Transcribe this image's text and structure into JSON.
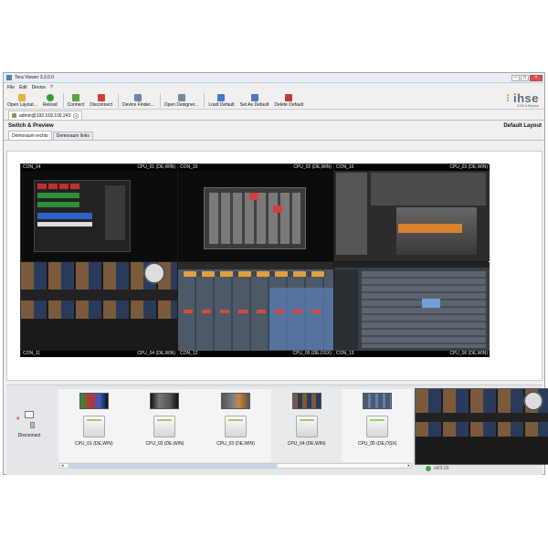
{
  "window": {
    "title": "Tera Viewer 3.3.0.0",
    "controls": {
      "minimize": "–",
      "maximize": "□",
      "close": "×"
    }
  },
  "menu": [
    "File",
    "Edit",
    "Device",
    "?"
  ],
  "toolbar": {
    "buttons": [
      {
        "label": "Open Layout...",
        "icon": "folder-icon",
        "color": "#e6b43c"
      },
      {
        "label": "Reload",
        "icon": "reload-icon",
        "color": "#3a9a3a"
      },
      {
        "label": "Connect",
        "icon": "connect-icon",
        "color": "#58a23c"
      },
      {
        "label": "Disconnect",
        "icon": "disconnect-icon",
        "color": "#d04030"
      },
      {
        "label": "Device Finder...",
        "icon": "device-finder-icon",
        "color": "#6b87a8"
      },
      {
        "label": "Open Designer...",
        "icon": "designer-icon",
        "color": "#7a8a9a"
      },
      {
        "label": "Load Default",
        "icon": "load-default-icon",
        "color": "#4a78c2"
      },
      {
        "label": "Set As Default",
        "icon": "set-default-icon",
        "color": "#4a78c2"
      },
      {
        "label": "Delete Default",
        "icon": "delete-default-icon",
        "color": "#c03a3a"
      }
    ]
  },
  "logo": {
    "name": "ihse",
    "tagline": "KVM & Beyond"
  },
  "connection_tab": {
    "label": "admin@192.169.100.243"
  },
  "section": {
    "title": "Switch & Preview",
    "layout": "Default Layout"
  },
  "subtabs": [
    {
      "label": "Demoraum rechts",
      "active": true
    },
    {
      "label": "Demoraum links",
      "active": false
    }
  ],
  "consoles": [
    {
      "con": "CON_14",
      "cpu": "CPU_01 (DE,WIN)",
      "label_pos": "top"
    },
    {
      "con": "CON_15",
      "cpu": "CPU_02 (DE,WIN)",
      "label_pos": "top"
    },
    {
      "con": "CON_16",
      "cpu": "CPU_03 (DE,WIN)",
      "label_pos": "top"
    },
    {
      "con": "CON_11",
      "cpu": "CPU_04 (DE,WIN)",
      "label_pos": "bottom"
    },
    {
      "con": "CON_12",
      "cpu": "CPU_05 (DE,OSX)",
      "label_pos": "bottom"
    },
    {
      "con": "CON_13",
      "cpu": "CPU_06 (DE,WIN)",
      "label_pos": "bottom"
    }
  ],
  "disconnect": {
    "label": "Disconnect"
  },
  "cpus": [
    {
      "label": "CPU_01 (DE,WIN)",
      "selected": false
    },
    {
      "label": "CPU_02 (DE,WIN)",
      "selected": false
    },
    {
      "label": "CPU_03 (DE,WIN)",
      "selected": false
    },
    {
      "label": "CPU_04 (DE,WIN)",
      "selected": true
    },
    {
      "label": "CPU_05 (DE,OSX)",
      "selected": false
    }
  ],
  "scroll": {
    "left_arrow": "◂",
    "right_arrow": "▸"
  },
  "status": {
    "text": "v6/3.03"
  }
}
